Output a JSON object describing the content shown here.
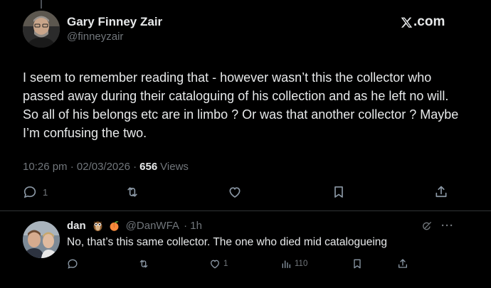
{
  "tweet": {
    "author_name": "Gary Finney Zair",
    "author_handle": "@finneyzair",
    "brand": "X.com",
    "text": "I seem to remember reading that - however wasn’t this the collector who passed away during their cataloguing of his collection and as he left no will. So all of his belongs etc are in limbo ? Or was that another collector ? Maybe I’m confusing the two.",
    "time": "10:26 pm",
    "date": "02/03/2026",
    "views_count": "656",
    "views_label": "Views",
    "reply_count": "1"
  },
  "reply": {
    "author_name": "dan",
    "emojis": [
      "owl",
      "peach"
    ],
    "author_handle": "@DanWFA",
    "age": "1h",
    "text": "No, that’s this same collector. The one who died mid catalogueing",
    "like_count": "1",
    "views_count": "110"
  },
  "icons": [
    "x-logo-icon",
    "reply-icon",
    "retweet-icon",
    "like-icon",
    "bookmark-icon",
    "share-icon",
    "grok-icon",
    "more-icon",
    "views-icon"
  ],
  "colors": {
    "background": "#000000",
    "text": "#e7e9ea",
    "muted": "#71767b",
    "divider": "#2f3336"
  }
}
